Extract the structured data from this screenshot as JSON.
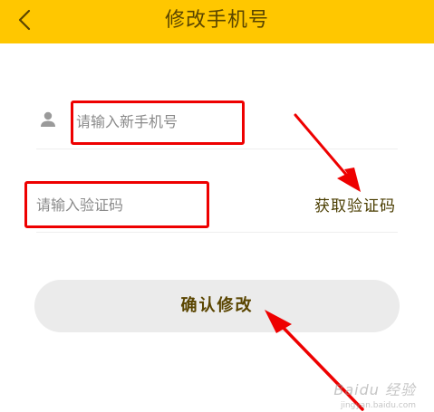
{
  "header": {
    "title": "修改手机号",
    "back_icon": "chevron-left-icon",
    "background_color": "#FFC700"
  },
  "form": {
    "phone_placeholder": "请输入新手机号",
    "phone_value": "",
    "user_icon": "user-icon",
    "code_placeholder": "请输入验证码",
    "code_value": "",
    "get_code_label": "获取验证码"
  },
  "confirm_button": {
    "label": "确认修改",
    "background_color": "#EBEBEB"
  },
  "annotations": {
    "highlight_color": "#EE0000"
  },
  "watermark": {
    "text": "Baidu 经验",
    "subtext": "jingyan.baidu.com"
  }
}
